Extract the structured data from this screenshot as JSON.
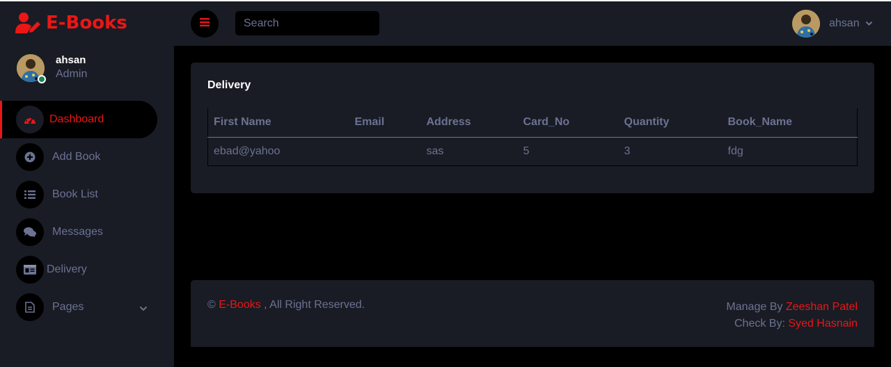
{
  "brand": {
    "name": "E-Books"
  },
  "search": {
    "placeholder": "Search"
  },
  "sidebar": {
    "profile": {
      "name": "ahsan",
      "role": "Admin"
    },
    "items": [
      {
        "label": "Dashboard",
        "icon": "tachometer-icon",
        "active": true
      },
      {
        "label": "Add Book",
        "icon": "plus-circle-icon"
      },
      {
        "label": "Book List",
        "icon": "list-icon"
      },
      {
        "label": "Messages",
        "icon": "comments-icon"
      },
      {
        "label": "Delivery",
        "icon": "id-card-icon"
      },
      {
        "label": "Pages",
        "icon": "file-icon"
      }
    ]
  },
  "topbar": {
    "username": "ahsan"
  },
  "card": {
    "title": "Delivery",
    "table": {
      "headers": [
        "First Name",
        "Email",
        "Address",
        "Card_No",
        "Quantity",
        "Book_Name"
      ],
      "rows": [
        [
          "ebad@yahoo",
          "",
          "sas",
          "5",
          "3",
          "fdg"
        ]
      ]
    }
  },
  "footer": {
    "copyright_symbol": "©",
    "brand": "E-Books",
    "rights": ", All Right Reserved.",
    "manage_label": "Manage By",
    "manage_name": "Zeeshan Patel",
    "check_label": "Check By:",
    "check_name": "Syed Hasnain"
  },
  "colors": {
    "accent": "#EB1616",
    "panel": "#191C24",
    "background": "#000000",
    "text": "#6C7293"
  }
}
